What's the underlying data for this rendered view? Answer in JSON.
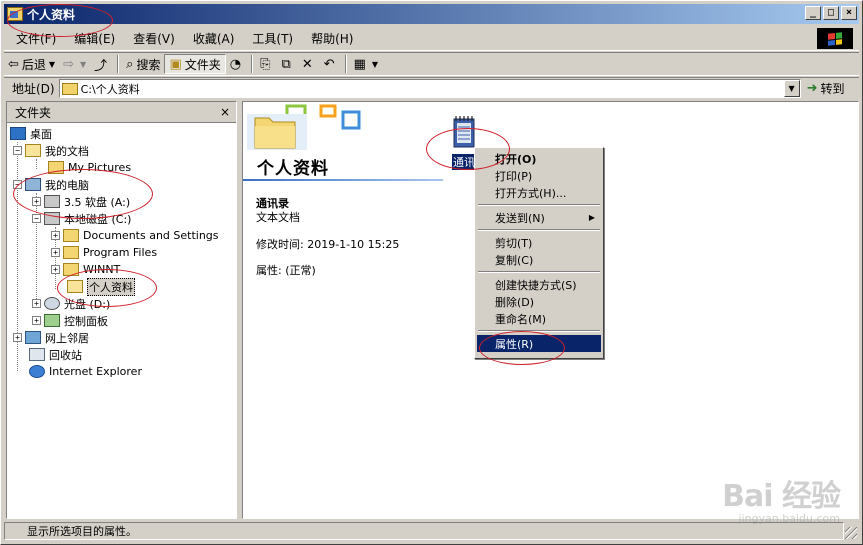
{
  "window": {
    "title": "个人资料",
    "caption_buttons": {
      "minimize": "_",
      "maximize": "□",
      "close": "×"
    }
  },
  "menu": [
    "文件(F)",
    "编辑(E)",
    "查看(V)",
    "收藏(A)",
    "工具(T)",
    "帮助(H)"
  ],
  "toolbar": {
    "back_label": "后退",
    "forward_label": "",
    "search_label": "搜索",
    "folders_label": "文件夹"
  },
  "address": {
    "label": "地址(D)",
    "value": "C:\\个人资料",
    "go_label": "转到"
  },
  "folder_pane": {
    "title": "文件夹",
    "close": "×",
    "tree": {
      "desktop": "桌面",
      "my_documents": "我的文档",
      "my_pictures": "My Pictures",
      "my_computer": "我的电脑",
      "floppy": "3.5 软盘 (A:)",
      "local_disk": "本地磁盘 (C:)",
      "docs_settings": "Documents and Settings",
      "program_files": "Program Files",
      "winnt": "WINNT",
      "personal": "个人资料",
      "cdrom": "光盘 (D:)",
      "control_panel": "控制面板",
      "network": "网上邻居",
      "recycle_bin": "回收站",
      "ie": "Internet Explorer"
    }
  },
  "main": {
    "folder_title": "个人资料",
    "selected_name": "通讯录",
    "selected_type": "文本文档",
    "modified": "修改时间: 2019-1-10 15:25",
    "attributes": "属性: (正常)",
    "file_label": "通讯"
  },
  "context_menu": {
    "open": "打开(O)",
    "print": "打印(P)",
    "open_with": "打开方式(H)...",
    "send_to": "发送到(N)",
    "cut": "剪切(T)",
    "copy": "复制(C)",
    "create_shortcut": "创建快捷方式(S)",
    "delete": "删除(D)",
    "rename": "重命名(M)",
    "properties": "属性(R)"
  },
  "status": "显示所选项目的属性。",
  "watermark": {
    "main": "Bai 经验",
    "sub": "jingyan.baidu.com"
  },
  "colors": {
    "title_start": "#0a246a",
    "title_end": "#a6caf0",
    "highlight": "#0a246a",
    "annotation": "#d0202a",
    "face": "#d4d0c8"
  }
}
